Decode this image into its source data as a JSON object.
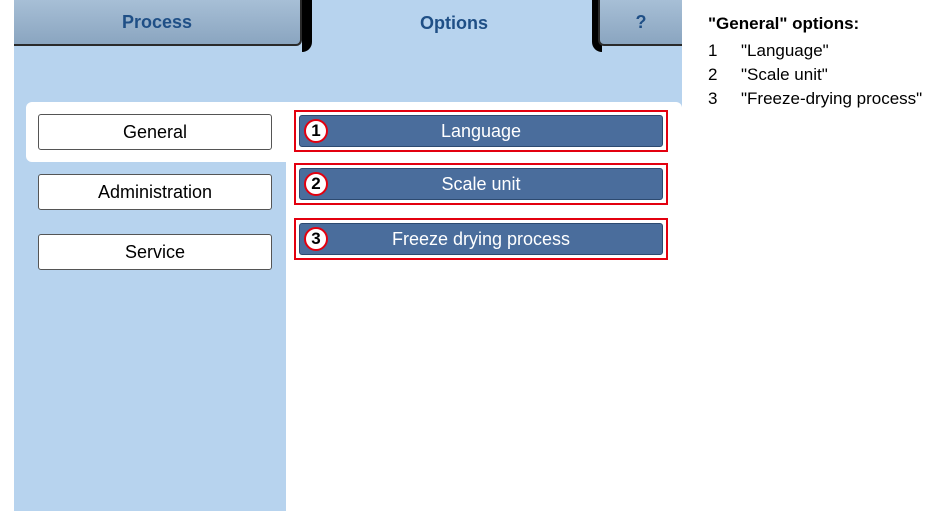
{
  "tabs": {
    "process": "Process",
    "options": "Options",
    "help": "?"
  },
  "nav": [
    {
      "label": "General"
    },
    {
      "label": "Administration"
    },
    {
      "label": "Service"
    }
  ],
  "options": [
    {
      "number": "1",
      "label": "Language"
    },
    {
      "number": "2",
      "label": "Scale unit"
    },
    {
      "number": "3",
      "label": "Freeze drying process"
    }
  ],
  "legend": {
    "title": "\"General\" options:",
    "items": [
      {
        "number": "1",
        "text": "\"Language\""
      },
      {
        "number": "2",
        "text": "\"Scale unit\""
      },
      {
        "number": "3",
        "text": "\"Freeze-drying process\""
      }
    ]
  },
  "colors": {
    "screen_bg": "#b7d3ee",
    "tab_text": "#1f4f86",
    "option_button": "#4a6d9c",
    "highlight_red": "#e3000f"
  }
}
